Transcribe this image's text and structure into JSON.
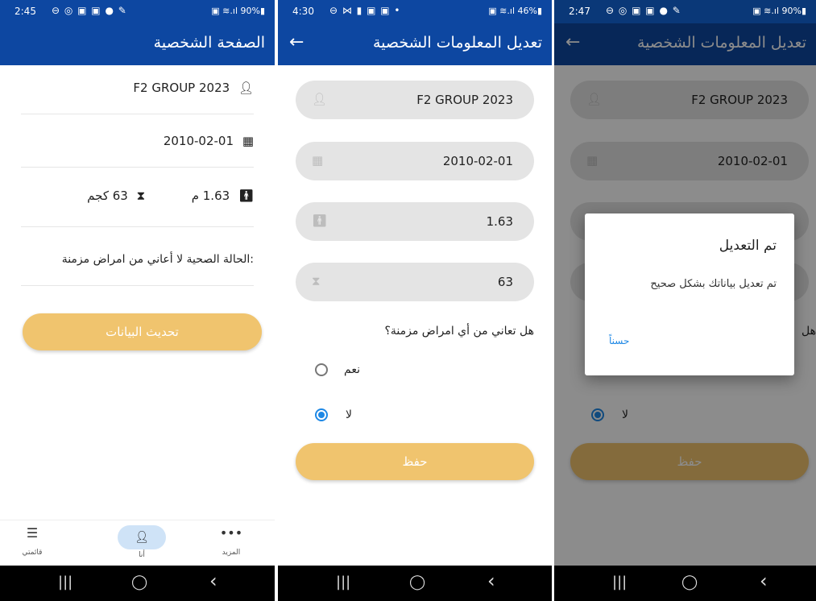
{
  "screen1": {
    "status": {
      "time": "2:45",
      "icons": "⊖ ◎ ▣ ▣ ● ✎",
      "right": "▣ ≋.ıl 90%▮"
    },
    "title": "الصفحة الشخصية",
    "name": "F2 GROUP 2023",
    "birthdate": "2010-02-01",
    "height": "1.63 م",
    "weight": "63 كجم",
    "health": ":الحالة الصحية لا أعاني من امراض مزمنة",
    "update_button": "تحديث البيانات",
    "bottom_nav": {
      "menu": "قائمتي",
      "me": "أنا",
      "more": "المزيد"
    }
  },
  "screen2": {
    "status": {
      "time": "4:30",
      "icons": "⊖ ⋈ ▮ ▣ ▣ •",
      "right": "▣ ≋.ıl 46%▮"
    },
    "title": "تعديل المعلومات الشخصية",
    "name": "F2 GROUP 2023",
    "birthdate": "2010-02-01",
    "height": "1.63",
    "weight": "63",
    "question": "هل تعاني من أي امراض مزمنة؟",
    "option_yes": "نعم",
    "option_no": "لا",
    "save_button": "حفظ"
  },
  "screen3": {
    "status": {
      "time": "2:47",
      "icons": "⊖ ◎ ▣ ▣ ● ✎",
      "right": "▣ ≋.ıl 90%▮"
    },
    "title": "تعديل المعلومات الشخصية",
    "name": "F2 GROUP 2023",
    "birthdate": "2010-02-01",
    "question_partial": "هل",
    "option_no": "لا",
    "save_button": "حفظ",
    "dialog": {
      "title": "تم التعديل",
      "message": "تم تعديل بياناتك بشكل صحيح",
      "ok": "حسناً"
    }
  },
  "system_nav": {
    "recents": "|||",
    "home": "◯",
    "back": "‹"
  },
  "colors": {
    "primary": "#0d47a1",
    "accent": "#f0c46e",
    "radio": "#1e88e5"
  }
}
